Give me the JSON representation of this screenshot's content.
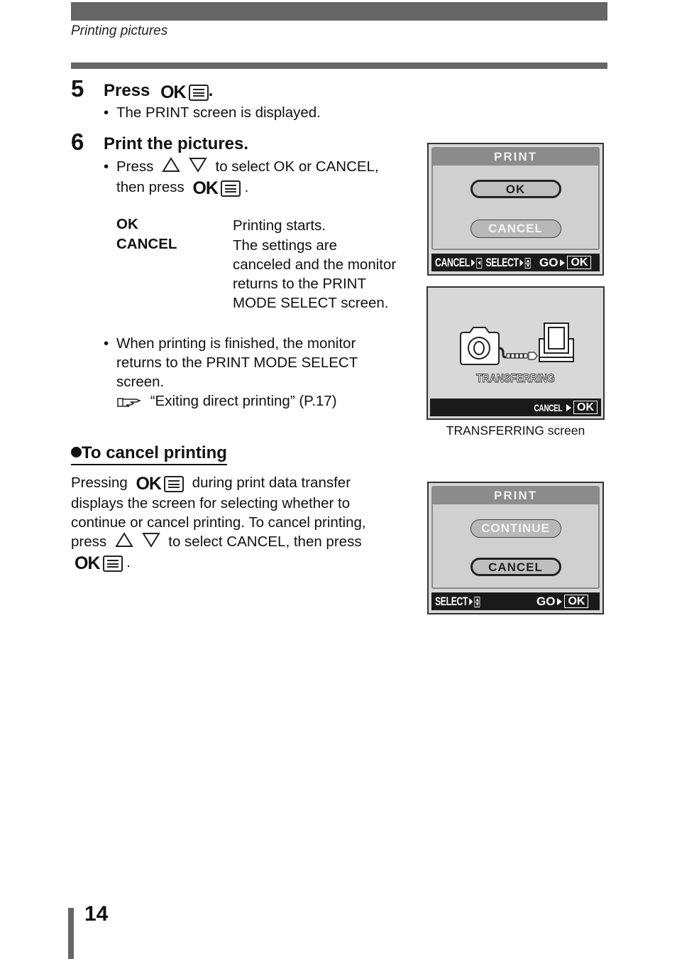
{
  "header": {
    "section_title": "Printing pictures"
  },
  "step5": {
    "number": "5",
    "heading": "Press",
    "ok_label": "OK",
    "heading_end": ".",
    "bullet": "The PRINT screen is displayed."
  },
  "step6": {
    "number": "6",
    "heading": "Print the pictures.",
    "bullet1_a": "Press",
    "bullet1_b": "to select OK or CANCEL,",
    "bullet1_c": "then press",
    "ok_label": "OK",
    "bullet1_end": ".",
    "definitions": [
      {
        "term": "OK",
        "desc": [
          "Printing starts."
        ]
      },
      {
        "term": "CANCEL",
        "desc": [
          "The settings are",
          "canceled and the monitor",
          "returns to the PRINT",
          "MODE SELECT screen."
        ]
      }
    ],
    "bullet2_lines": [
      "When printing is finished, the monitor",
      "returns to the PRINT MODE SELECT",
      "screen."
    ],
    "reference": "“Exiting direct printing” (P.17)"
  },
  "cancel_section": {
    "heading": "To cancel printing",
    "ok_label": "OK",
    "line1_a": "Pressing",
    "line1_b": "during print data transfer",
    "line2": "displays the screen for selecting whether to",
    "line3": "continue or cancel printing. To cancel printing,",
    "line4_a": "press",
    "line4_b": "to select CANCEL, then press",
    "line5_end": "."
  },
  "screens": {
    "print_screen": {
      "title": "PRINT",
      "options": [
        "OK",
        "CANCEL"
      ],
      "selected": "OK",
      "footer": {
        "cancel": "CANCEL",
        "select": "SELECT",
        "go": "GO",
        "ok": "OK"
      }
    },
    "transferring_screen": {
      "status": "TRANSFERRING",
      "footer": {
        "cancel": "CANCEL",
        "ok": "OK"
      },
      "caption": "TRANSFERRING screen"
    },
    "print_continue_screen": {
      "title": "PRINT",
      "options": [
        "CONTINUE",
        "CANCEL"
      ],
      "selected": "CANCEL",
      "footer": {
        "select": "SELECT",
        "go": "GO",
        "ok": "OK"
      }
    }
  },
  "footer": {
    "page_number": "14"
  }
}
